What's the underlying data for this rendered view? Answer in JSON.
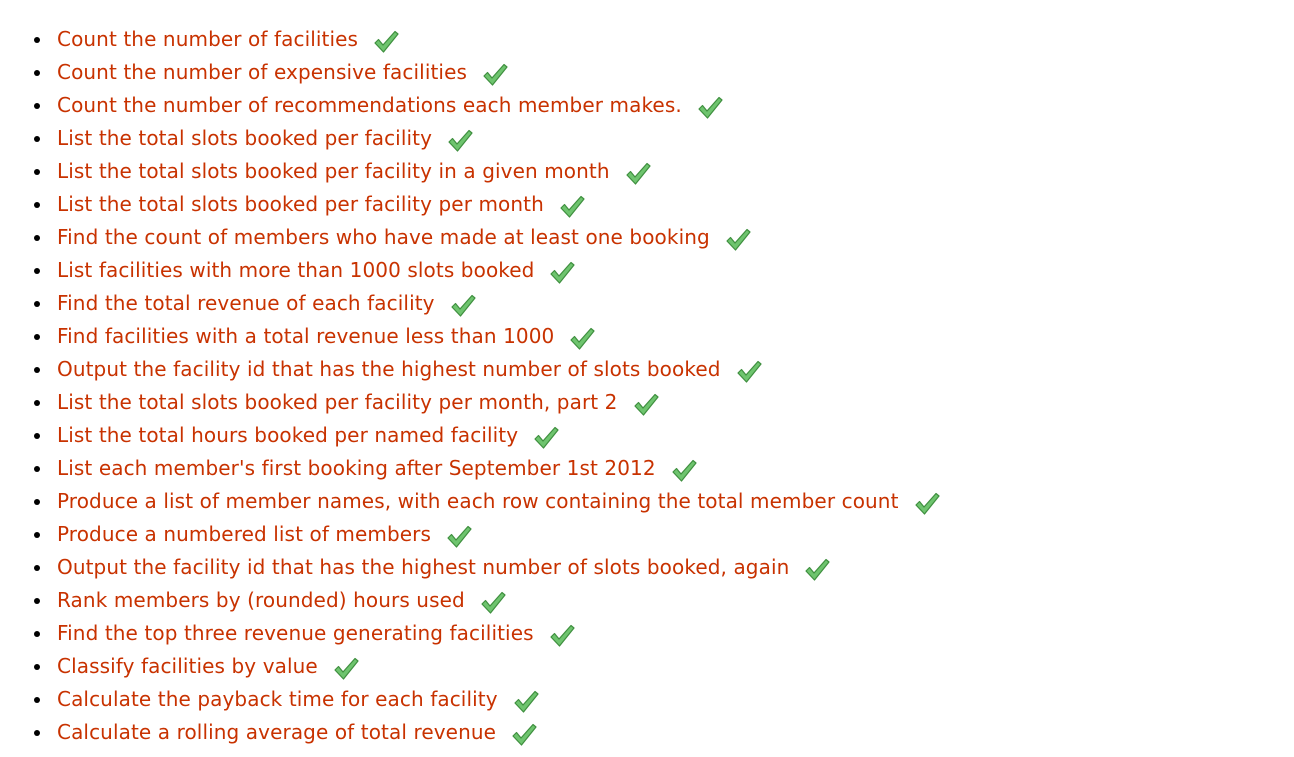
{
  "colors": {
    "link": "#c83200",
    "check_fill": "#6ec46e",
    "check_stroke": "#3f8f3f"
  },
  "icons": {
    "completed": "check-icon"
  },
  "exercises": [
    {
      "label": "Count the number of facilities",
      "completed": true
    },
    {
      "label": "Count the number of expensive facilities",
      "completed": true
    },
    {
      "label": "Count the number of recommendations each member makes.",
      "completed": true
    },
    {
      "label": "List the total slots booked per facility",
      "completed": true
    },
    {
      "label": "List the total slots booked per facility in a given month",
      "completed": true
    },
    {
      "label": "List the total slots booked per facility per month",
      "completed": true
    },
    {
      "label": "Find the count of members who have made at least one booking",
      "completed": true
    },
    {
      "label": "List facilities with more than 1000 slots booked",
      "completed": true
    },
    {
      "label": "Find the total revenue of each facility",
      "completed": true
    },
    {
      "label": "Find facilities with a total revenue less than 1000",
      "completed": true
    },
    {
      "label": "Output the facility id that has the highest number of slots booked",
      "completed": true
    },
    {
      "label": "List the total slots booked per facility per month, part 2",
      "completed": true
    },
    {
      "label": "List the total hours booked per named facility",
      "completed": true
    },
    {
      "label": "List each member's first booking after September 1st 2012",
      "completed": true
    },
    {
      "label": "Produce a list of member names, with each row containing the total member count",
      "completed": true
    },
    {
      "label": "Produce a numbered list of members",
      "completed": true
    },
    {
      "label": "Output the facility id that has the highest number of slots booked, again",
      "completed": true
    },
    {
      "label": "Rank members by (rounded) hours used",
      "completed": true
    },
    {
      "label": "Find the top three revenue generating facilities",
      "completed": true
    },
    {
      "label": "Classify facilities by value",
      "completed": true
    },
    {
      "label": "Calculate the payback time for each facility",
      "completed": true
    },
    {
      "label": "Calculate a rolling average of total revenue",
      "completed": true
    }
  ]
}
